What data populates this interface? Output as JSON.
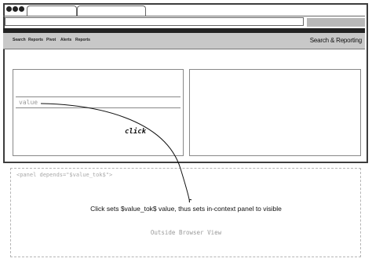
{
  "app": {
    "title": "Search & Reporting"
  },
  "nav": {
    "items": [
      "Search",
      "Reports",
      "Pivot",
      "Alerts",
      "Reports"
    ]
  },
  "panel_left": {
    "value_text": "value"
  },
  "diagram": {
    "click_label": "click",
    "panel_tag": "<panel depends=\"$value_tok$\">",
    "caption": "Click sets $value_tok$ value, thus sets in-context panel to visible",
    "outside_label": "Outside Browser View"
  }
}
